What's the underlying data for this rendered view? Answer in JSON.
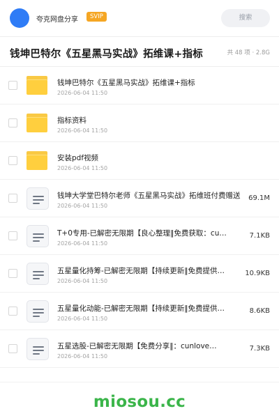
{
  "header": {
    "username": "夸克网盘分享",
    "vip_badge": "SVIP",
    "search_placeholder": "搜索"
  },
  "folder": {
    "title": "钱坤巴特尔《五星黑马实战》拓维课+指标",
    "meta": "共 48 项 · 2.8G"
  },
  "files": [
    {
      "type": "folder",
      "name": "钱坤巴特尔《五星黑马实战》拓维课+指标",
      "date": "2026-06-04 11:50",
      "size": ""
    },
    {
      "type": "folder",
      "name": "指标资料",
      "date": "2026-06-04 11:50",
      "size": ""
    },
    {
      "type": "folder",
      "name": "安装pdf视频",
      "date": "2026-06-04 11:50",
      "size": ""
    },
    {
      "type": "file",
      "name": "钱坤大学堂巴特尔老师《五星黑马实战》拓维班付费赠送",
      "date": "2026-06-04 11:50",
      "size": "69.1M"
    },
    {
      "type": "file",
      "name": "T+0专用-已解密无限期【良心整理‖免费获取：cu…",
      "date": "2026-06-04 11:50",
      "size": "7.1KB"
    },
    {
      "type": "file",
      "name": "五星量化持筹-已解密无限期【持续更新‖免费提供：c…",
      "date": "2026-06-04 11:50",
      "size": "10.9KB"
    },
    {
      "type": "file",
      "name": "五星量化动能-已解密无限期【持续更新‖免费提供：C…",
      "date": "2026-06-04 11:50",
      "size": "8.6KB"
    },
    {
      "type": "file",
      "name": "五星选股-已解密无限期【免费分享‖：cunlove…",
      "date": "2026-06-04 11:50",
      "size": "7.3KB"
    }
  ],
  "icons": {
    "folder": "folder-icon",
    "file": "document-icon"
  },
  "colors": {
    "avatar": "#2f7cf6",
    "vip": "#f5a623",
    "folder": "#ffcf3e",
    "watermark": "#3bb54a"
  },
  "footer": {
    "watermark": "miosou.cc"
  }
}
